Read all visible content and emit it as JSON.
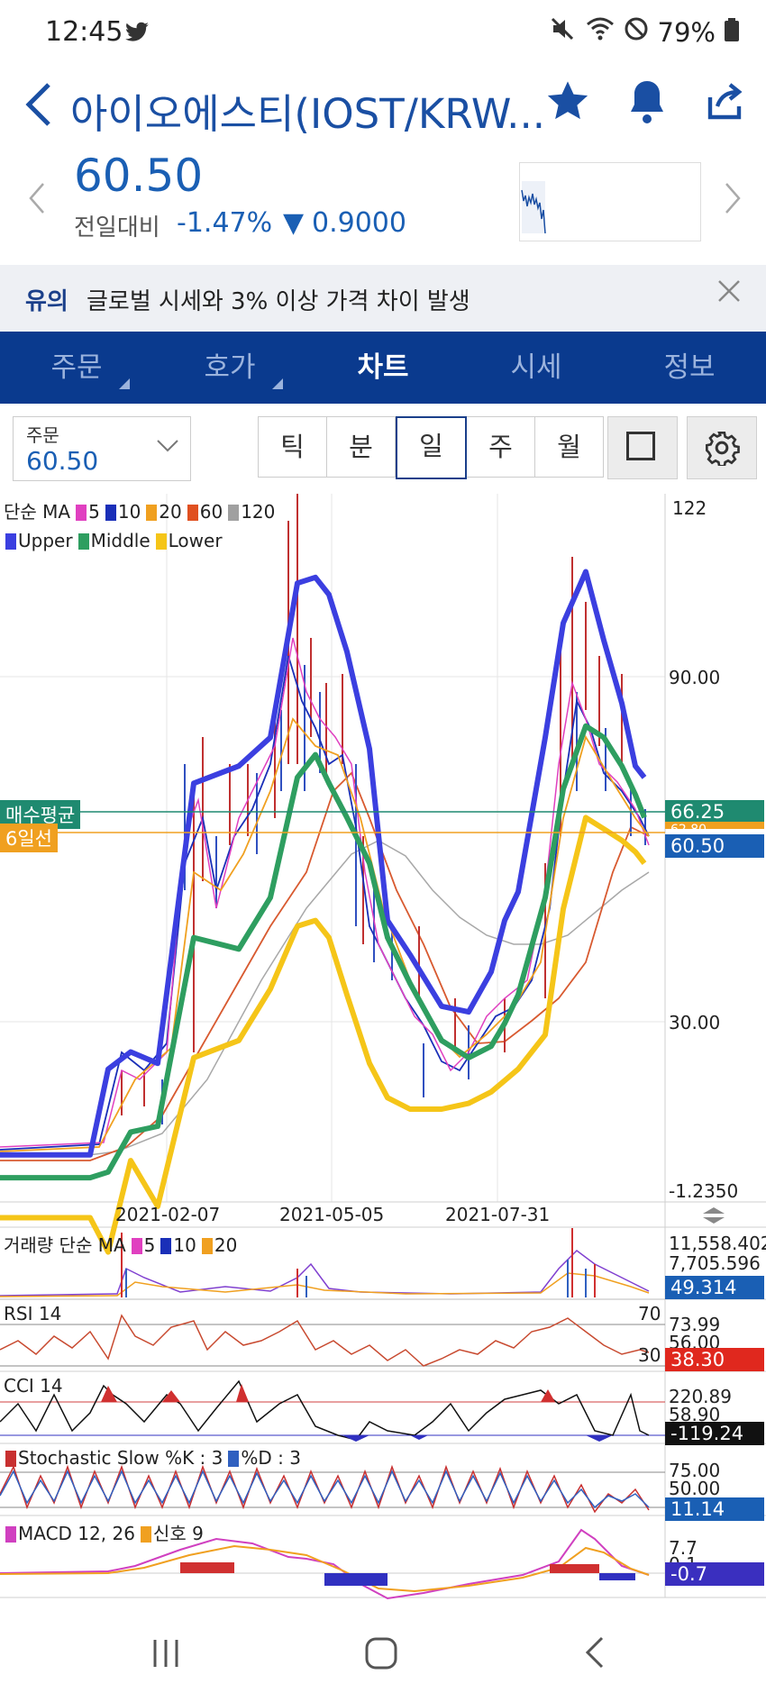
{
  "status_bar": {
    "time": "12:45",
    "battery": "79%"
  },
  "header": {
    "title": "아이오에스티(IOST/KRW..."
  },
  "price": {
    "current": "60.50",
    "change_label": "전일대비",
    "change_pct": "-1.47%",
    "change_abs": "0.9000"
  },
  "notice": {
    "tag": "유의",
    "message": "글로벌 시세와 3% 이상 가격 차이 발생"
  },
  "tabs": [
    {
      "label": "주문"
    },
    {
      "label": "호가"
    },
    {
      "label": "차트"
    },
    {
      "label": "시세"
    },
    {
      "label": "정보"
    }
  ],
  "order_box": {
    "label": "주문",
    "value": "60.50"
  },
  "periods": [
    "틱",
    "분",
    "일",
    "주",
    "월"
  ],
  "main_chart": {
    "legend_ma": {
      "prefix": "단순 MA",
      "items": [
        "5",
        "10",
        "20",
        "60",
        "120"
      ]
    },
    "legend_bb": [
      "Upper",
      "Middle",
      "Lower"
    ],
    "y_labels": [
      "122",
      "90.00",
      "30.00",
      "-1.2350"
    ],
    "avg_buy_label": "매수평균",
    "ma6_label": "6일선",
    "avg_buy_value": "66.25",
    "hidden_value": "62.80",
    "last_price": "60.50",
    "x_labels": [
      "2021-02-07",
      "2021-05-05",
      "2021-07-31"
    ]
  },
  "volume": {
    "legend_prefix": "거래량 단순 MA",
    "items": [
      "5",
      "10",
      "20"
    ],
    "y1": "11,558.402",
    "y2": "7,705.596",
    "last": "49.314"
  },
  "rsi": {
    "label": "RSI 14",
    "level_high": "70",
    "level_low": "30",
    "y1": "73.99",
    "y2": "56.00",
    "last": "38.30"
  },
  "cci": {
    "label": "CCI 14",
    "y1": "220.89",
    "y2": "58.90",
    "last": "-119.24"
  },
  "stoch": {
    "label_k": "Stochastic Slow %K : 3",
    "label_d": "%D : 3",
    "y1": "75.00",
    "y2": "50.00",
    "last": "11.14"
  },
  "macd": {
    "label": "MACD 12, 26",
    "signal": "신호 9",
    "y1": "7.7",
    "y2": "0.1",
    "last": "-0.7"
  },
  "colors": {
    "brand": "#0a3a8e",
    "price_blue": "#1a5fb4",
    "upper": "#3b3fe0",
    "middle": "#2e9e60",
    "lower": "#f5c518",
    "ma5": "#e040c0",
    "ma10": "#1a2fb8",
    "ma20": "#f0a020",
    "ma60": "#e05020",
    "ma120": "#a0a0a0"
  },
  "chart_data": [
    {
      "type": "line",
      "title": "",
      "x": [
        "2021-02-07",
        "2021-05-05",
        "2021-07-31"
      ],
      "ylim": [
        -1.235,
        122
      ],
      "series": [
        {
          "name": "Upper",
          "values": [
            7,
            50,
            108,
            36,
            108,
            73
          ]
        },
        {
          "name": "Middle",
          "values": [
            3,
            22,
            78,
            25,
            82,
            64
          ]
        },
        {
          "name": "Lower",
          "values": [
            -4,
            -3,
            48,
            15,
            66,
            59
          ]
        }
      ]
    }
  ]
}
